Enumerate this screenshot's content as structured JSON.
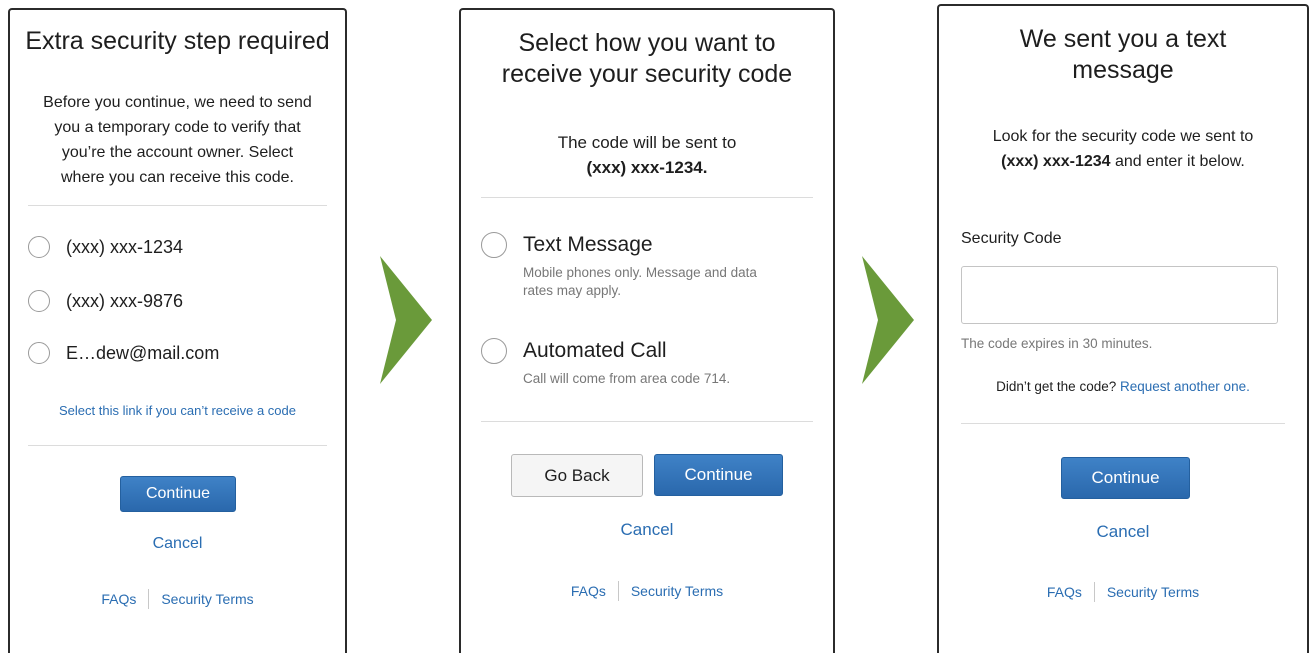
{
  "panel1": {
    "title": "Extra security step required",
    "description": [
      "Before you continue, we need to send",
      "you a temporary code to verify that",
      "you’re the account owner. Select",
      "where you can receive this code."
    ],
    "options": [
      "(xxx) xxx-1234",
      "(xxx) xxx-9876",
      "E…dew@mail.com"
    ],
    "alt_link": "Select this link if you can’t receive a code",
    "continue_label": "Continue",
    "cancel_label": "Cancel",
    "footer": {
      "faqs": "FAQs",
      "security_terms": "Security Terms"
    }
  },
  "panel2": {
    "title_lines": [
      "Select how you want to",
      "receive your security code"
    ],
    "intro": "The code will be sent to",
    "phone": "(xxx) xxx-1234.",
    "options": [
      {
        "label": "Text Message",
        "sub_lines": [
          "Mobile phones only. Message and data",
          "rates may apply."
        ]
      },
      {
        "label": "Automated Call",
        "sub_lines": [
          "Call will come from area code 714."
        ]
      }
    ],
    "back_label": "Go Back",
    "continue_label": "Continue",
    "cancel_label": "Cancel",
    "footer": {
      "faqs": "FAQs",
      "security_terms": "Security Terms"
    }
  },
  "panel3": {
    "title_lines": [
      "We sent you a text",
      "message"
    ],
    "line1": "Look for the security code we sent to",
    "phone": "(xxx) xxx-1234",
    "line2_rest": " and enter it below.",
    "field_label": "Security Code",
    "field_value": "",
    "expiry_hint": "The code expires in 30 minutes.",
    "resend_prompt": "Didn’t get the code? ",
    "resend_link": "Request another one.",
    "continue_label": "Continue",
    "cancel_label": "Cancel",
    "footer": {
      "faqs": "FAQs",
      "security_terms": "Security Terms"
    }
  },
  "icons": {
    "step_arrow": "chevron-right-icon"
  },
  "colors": {
    "arrow": "#6a9a3a",
    "primary": "#2e6fb3",
    "link": "#2a6db2"
  }
}
